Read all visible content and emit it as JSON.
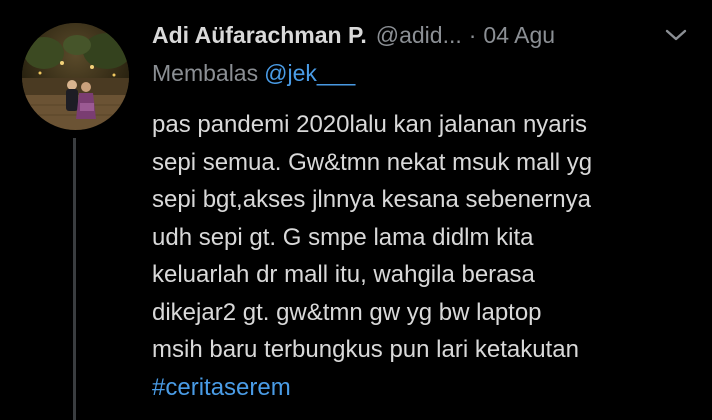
{
  "tweet": {
    "display_name": "Adi Aüfarachman P.",
    "handle": "@adid...",
    "separator": "·",
    "date": "04 Agu",
    "reply_prefix": "Membalas",
    "reply_mention": "@jek___",
    "body_lines": [
      "pas pandemi 2020lalu kan jalanan nyaris",
      "sepi semua. Gw&tmn nekat msuk mall yg",
      "sepi bgt,akses jlnnya kesana sebenernya",
      "udh sepi gt. G smpe lama didlm kita",
      "keluarlah dr mall itu, wahgila berasa",
      "dikejar2 gt. gw&tmn gw yg bw laptop",
      "msih baru terbungkus pun lari ketakutan"
    ],
    "hashtag": "#ceritaserem"
  },
  "icons": {
    "avatar": "profile-photo",
    "caret": "chevron-down-icon"
  },
  "colors": {
    "background": "#000000",
    "text_primary": "#d9d9d9",
    "text_secondary": "#8b8f94",
    "link": "#4a9ce6"
  }
}
